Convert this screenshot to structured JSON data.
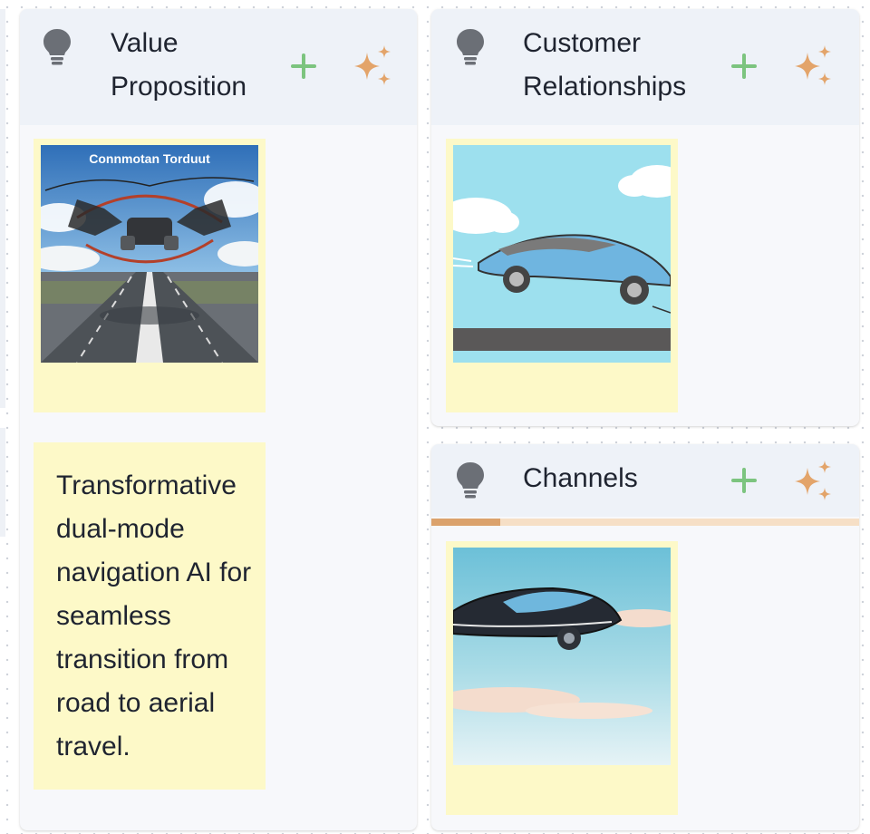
{
  "board": {
    "panels": [
      {
        "id": "value-proposition",
        "title_line1": "Value",
        "title_line2": "Proposition",
        "icon": "lightbulb-icon",
        "add_icon": "plus-icon",
        "ai_icon": "sparkles-icon",
        "image_note": {
          "image_caption": "Connmotan Torduut"
        },
        "text_note": "Transformative dual-mode navigation AI for seamless transition from road to aerial travel."
      },
      {
        "id": "customer-relationships",
        "title_line1": "Customer",
        "title_line2": "Relationships",
        "icon": "lightbulb-icon",
        "add_icon": "plus-icon",
        "ai_icon": "sparkles-icon"
      },
      {
        "id": "channels",
        "title_line1": "Channels",
        "icon": "lightbulb-icon",
        "add_icon": "plus-icon",
        "ai_icon": "sparkles-icon",
        "progress_fraction": 0.16
      }
    ]
  },
  "colors": {
    "accent_green": "#7cc47f",
    "accent_orange": "#e3a46a",
    "note_yellow": "#fdf9c8",
    "header_bg": "#eef2f8"
  }
}
